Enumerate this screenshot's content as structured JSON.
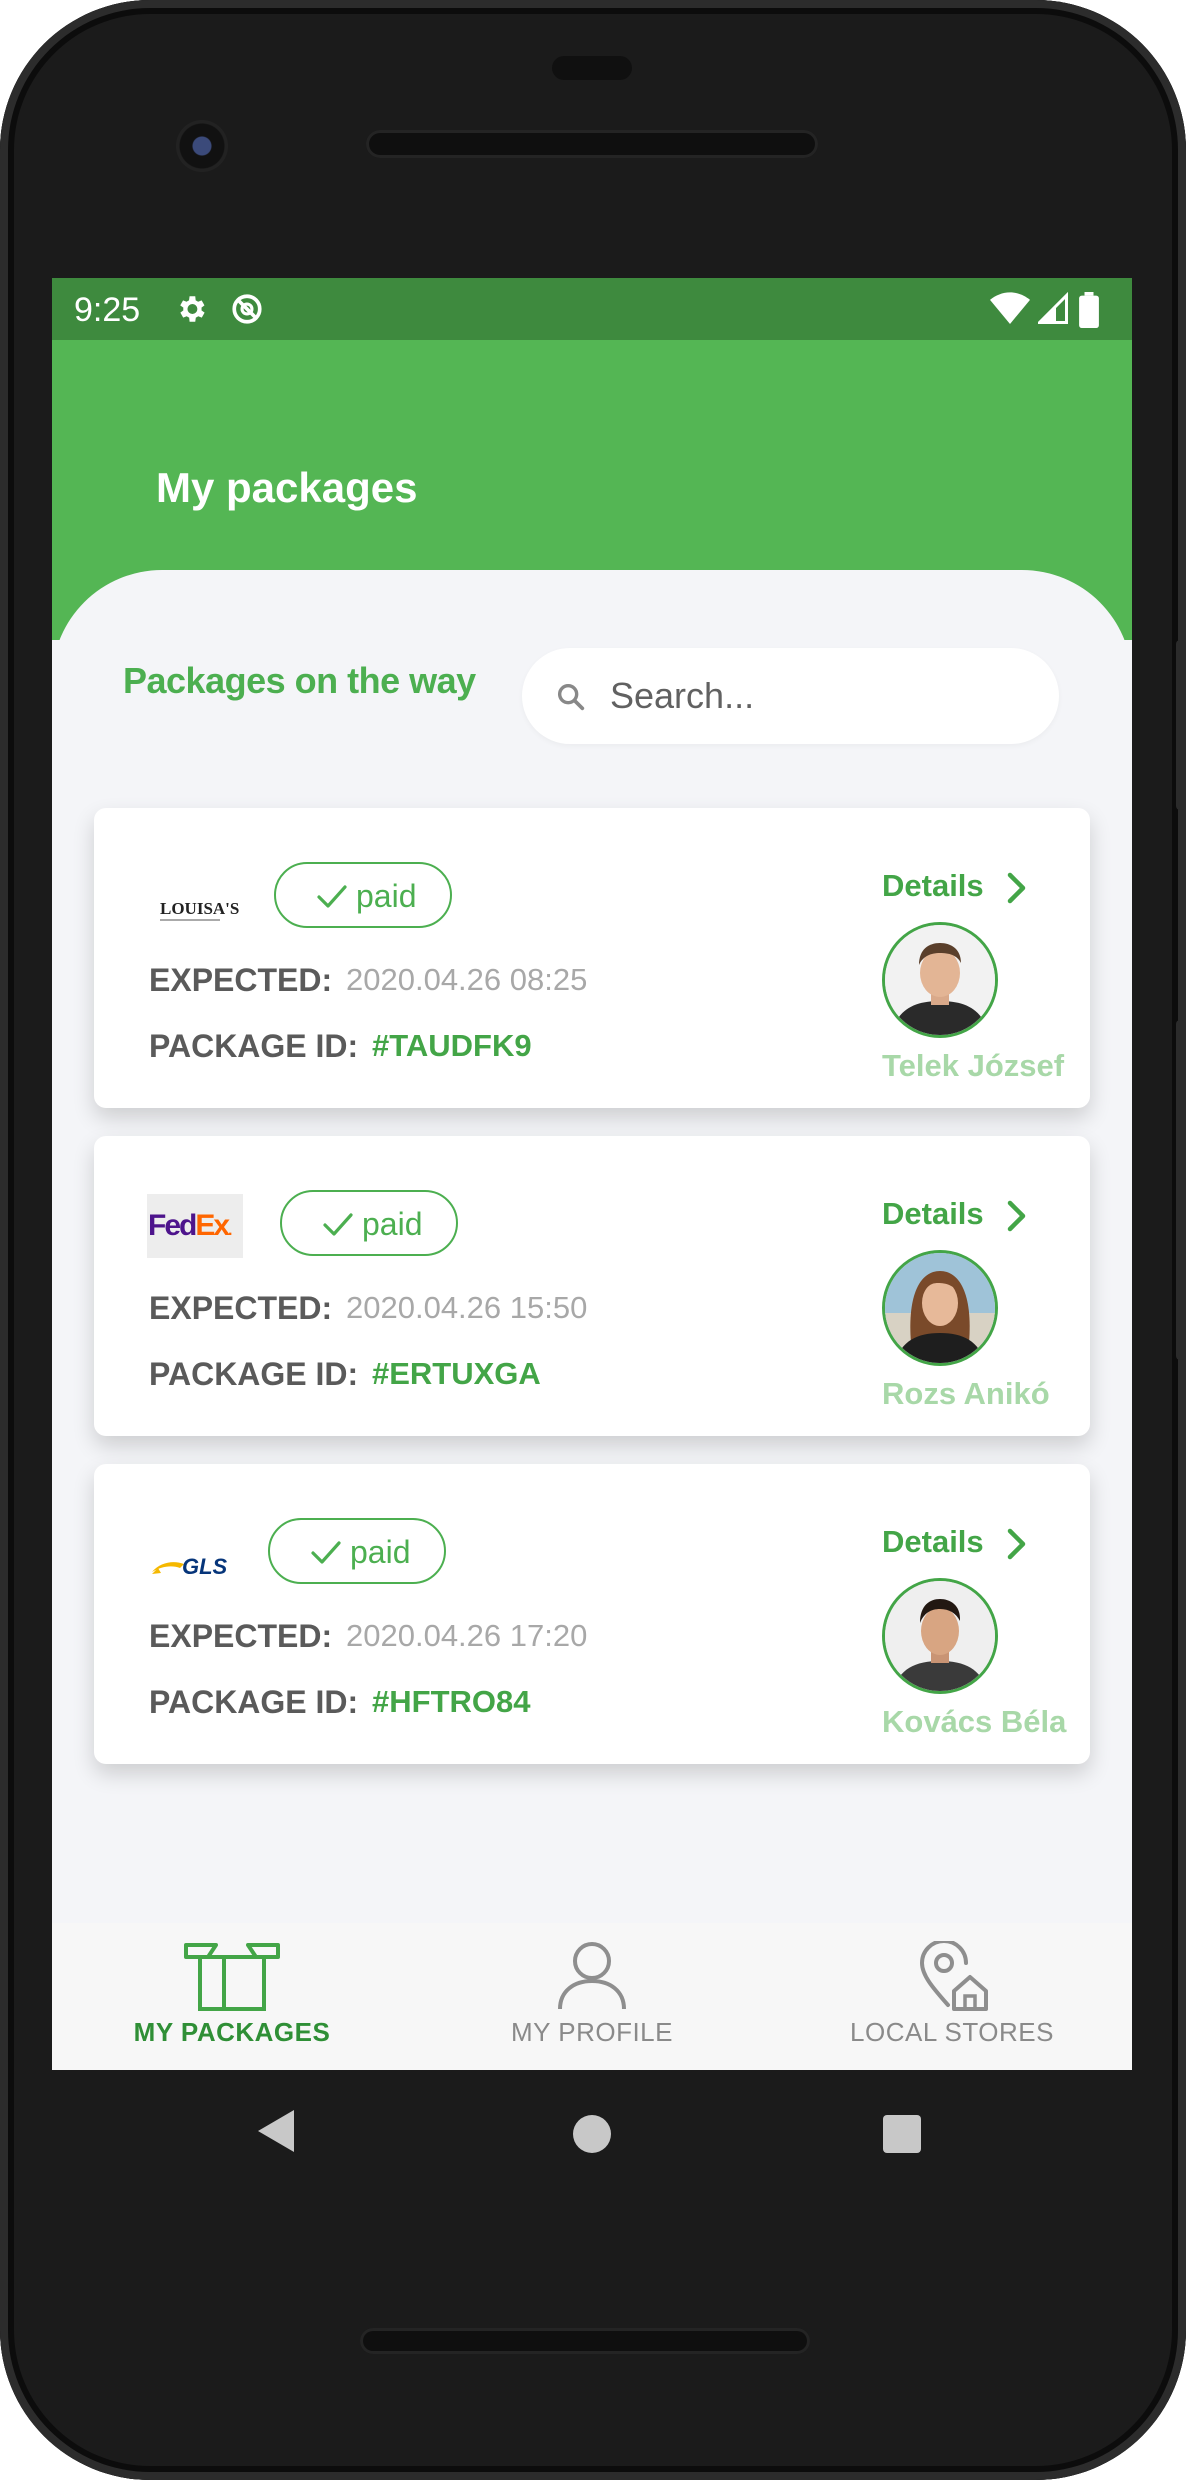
{
  "status_bar": {
    "time": "9:25"
  },
  "app_bar": {
    "title": "My packages"
  },
  "section": {
    "title": "Packages on the way"
  },
  "search": {
    "placeholder": "Search..."
  },
  "packages": [
    {
      "carrier_logo": "LOUISA'S",
      "status": "paid",
      "expected_label": "EXPECTED:",
      "expected_value": "2020.04.26 08:25",
      "id_label": "PACKAGE ID:",
      "id_value": "#TAUDFK9",
      "details_label": "Details",
      "courier_name": "Telek József"
    },
    {
      "carrier_logo": "FedEx",
      "status": "paid",
      "expected_label": "EXPECTED:",
      "expected_value": "2020.04.26 15:50",
      "id_label": "PACKAGE ID:",
      "id_value": "#ERTUXGA",
      "details_label": "Details",
      "courier_name": "Rozs Anikó"
    },
    {
      "carrier_logo": "GLS",
      "status": "paid",
      "expected_label": "EXPECTED:",
      "expected_value": "2020.04.26 17:20",
      "id_label": "PACKAGE ID:",
      "id_value": "#HFTRO84",
      "details_label": "Details",
      "courier_name": "Kovács Béla"
    }
  ],
  "bottom_nav": [
    {
      "label": "MY PACKAGES",
      "icon": "package-icon",
      "active": true
    },
    {
      "label": "MY PROFILE",
      "icon": "person-icon",
      "active": false
    },
    {
      "label": "LOCAL STORES",
      "icon": "store-location-icon",
      "active": false
    }
  ],
  "colors": {
    "primary": "#54b654",
    "status_bar": "#3e8a3e",
    "accent_text": "#43a547",
    "courier_name": "#a8d8a8",
    "background": "#f4f5f8"
  }
}
